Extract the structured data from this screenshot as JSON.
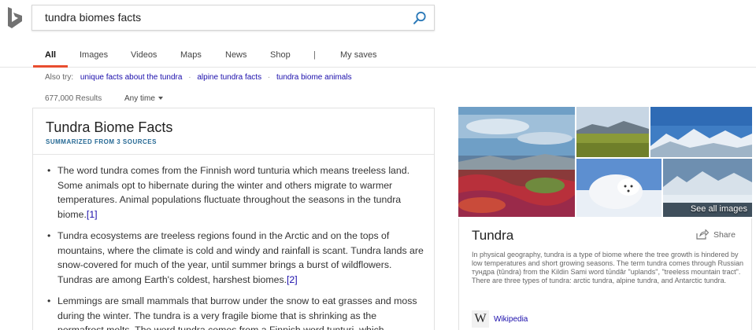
{
  "search": {
    "query": "tundra biomes facts",
    "submit_icon": "search-icon"
  },
  "logo": {
    "icon": "bing-logo-icon",
    "color": "#727272"
  },
  "nav": {
    "tabs": [
      {
        "label": "All"
      },
      {
        "label": "Images"
      },
      {
        "label": "Videos"
      },
      {
        "label": "Maps"
      },
      {
        "label": "News"
      },
      {
        "label": "Shop"
      }
    ],
    "separator": "|",
    "my_saves": "My saves",
    "accent_color": "#e84d2f"
  },
  "also_try": {
    "label": "Also try:",
    "links": [
      "unique facts about the tundra",
      "alpine tundra facts",
      "tundra biome animals"
    ]
  },
  "results": {
    "count": "677,000 Results",
    "time_filter": "Any time"
  },
  "answer_card": {
    "title": "Tundra Biome Facts",
    "subtitle": "SUMMARIZED FROM 3 SOURCES",
    "facts": [
      {
        "text": "The word tundra comes from the Finnish word tunturia which means treeless land. Some animals opt to hibernate during the winter and others migrate to warmer temperatures. Animal populations fluctuate throughout the seasons in the tundra biome.",
        "ref": "[1]"
      },
      {
        "text": "Tundra ecosystems are treeless regions found in the Arctic and on the tops of mountains, where the climate is cold and windy and rainfall is scant. Tundra lands are snow-covered for much of the year, until summer brings a burst of wildflowers. Tundras are among Earth's coldest, harshest biomes.",
        "ref": "[2]"
      },
      {
        "text": "Lemmings are small mammals that burrow under the snow to eat grasses and moss during the winter. The tundra is a very fragile biome that is shrinking as the permafrost melts. The word tundra comes from a Finnish word tunturi, which",
        "ref": ""
      }
    ]
  },
  "images": {
    "see_all": "See all images"
  },
  "knowledge_panel": {
    "title": "Tundra",
    "share_label": "Share",
    "description": "In physical geography, tundra is a type of biome where the tree growth is hindered by low temperatures and short growing seasons. The term tundra comes through Russian тундра (tûndra) from the Kildin Sami word tūndâr \"uplands\", \"treeless mountain tract\". There are three types of tundra: arctic tundra, alpine tundra, and Antarctic tundra.",
    "source_label": "Wikipedia",
    "source_icon": "W"
  }
}
